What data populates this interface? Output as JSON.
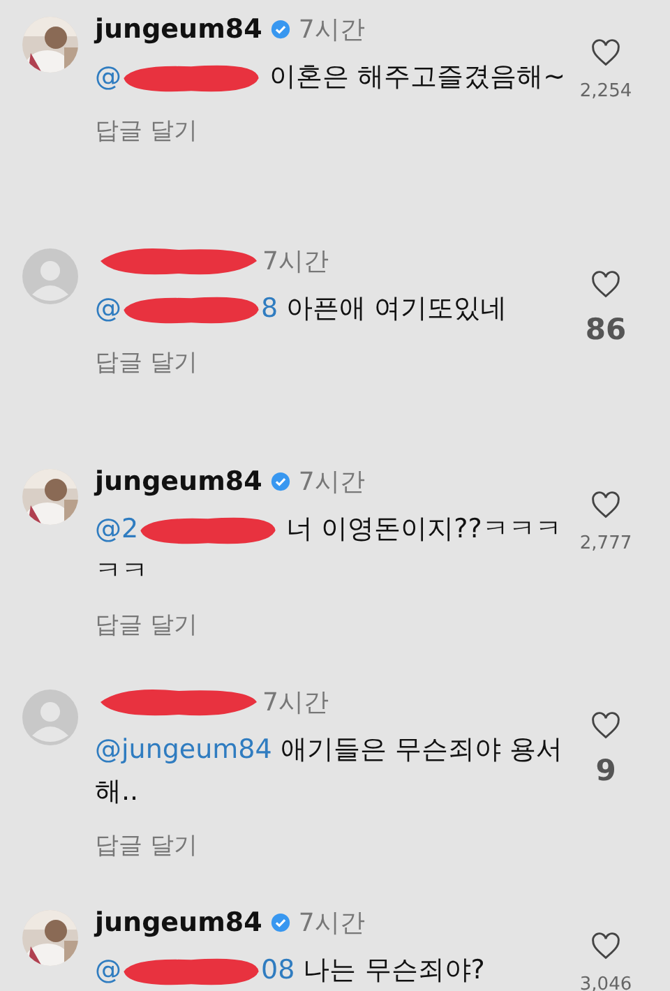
{
  "comments": [
    {
      "username": "jungeum84",
      "verified": true,
      "time": "7시간",
      "mention": "@",
      "mention_redacted": true,
      "text": "이혼은 해주고즐겼음해~",
      "reply": "답글 달기",
      "likes": "2,254",
      "large_count": false
    },
    {
      "avatar": {
        "kind": "default"
      },
      "verified": false,
      "time": "7시간",
      "mention": "@",
      "mention_redacted": true,
      "mention_tail": "8",
      "text": "아픈애 여기또있네",
      "reply": "답글 달기",
      "likes": "86",
      "large_count": true
    },
    {
      "username": "jungeum84",
      "verified": true,
      "time": "7시간",
      "mention": "@2",
      "mention_redacted": true,
      "text": "너 이영돈이지??ㅋㅋㅋㅋㅋ",
      "reply": "답글 달기",
      "likes": "2,777",
      "large_count": false
    },
    {
      "avatar": {
        "kind": "default"
      },
      "verified": false,
      "time": "7시간",
      "mention": "@jungeum84",
      "mention_redacted": false,
      "text": "애기들은 무슨죄야  용서해..",
      "reply": "답글 달기",
      "likes": "9",
      "large_count": true
    },
    {
      "username": "jungeum84",
      "verified": true,
      "time": "7시간",
      "mention": "@",
      "mention_redacted": true,
      "mention_tail": "08",
      "text": "나는 무슨죄야?",
      "likes": "3,046",
      "large_count": false
    }
  ]
}
